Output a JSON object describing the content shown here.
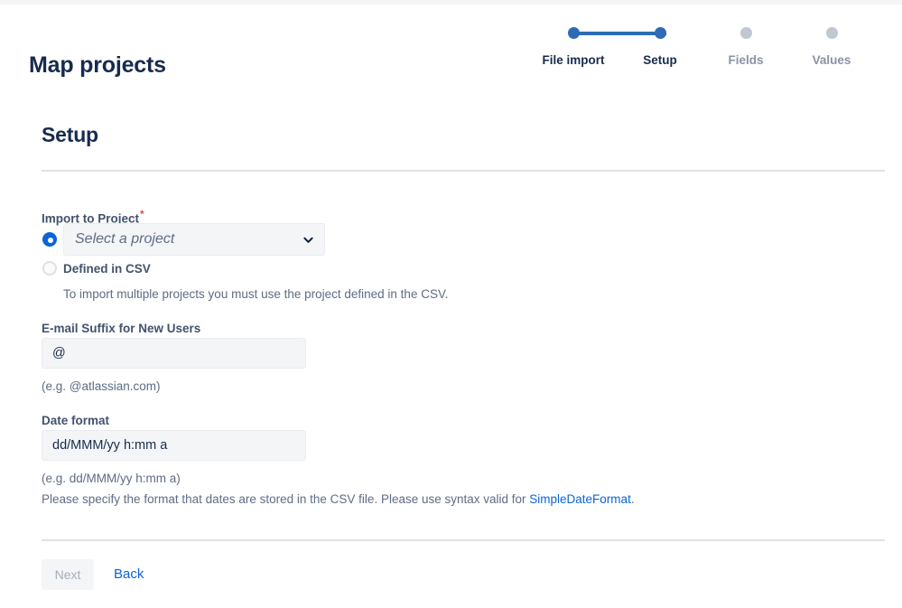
{
  "header": {
    "title": "Map projects"
  },
  "stepper": {
    "steps": [
      {
        "label": "File import",
        "state": "done"
      },
      {
        "label": "Setup",
        "state": "current"
      },
      {
        "label": "Fields",
        "state": "upcoming"
      },
      {
        "label": "Values",
        "state": "upcoming"
      }
    ],
    "active_color": "#2D6CB5",
    "inactive_color": "#C1C7D0"
  },
  "section": {
    "title": "Setup"
  },
  "form": {
    "import_to_project": {
      "label": "Import to Project",
      "required_marker": "*",
      "option_select": {
        "selected": true,
        "placeholder": "Select a project",
        "chevron": "chevron-down-icon"
      },
      "option_csv": {
        "selected": false,
        "label": "Defined in CSV",
        "helper": "To import multiple projects you must use the project defined in the CSV."
      }
    },
    "email_suffix": {
      "label": "E-mail Suffix for New Users",
      "value": "@",
      "helper": "(e.g. @atlassian.com)"
    },
    "date_format": {
      "label": "Date format",
      "value": "dd/MMM/yy h:mm a",
      "helper": "(e.g. dd/MMM/yy h:mm a)",
      "note_before": "Please specify the format that dates are stored in the CSV file. Please use syntax valid for ",
      "note_link": "SimpleDateFormat",
      "note_after": "."
    }
  },
  "actions": {
    "next_label": "Next",
    "back_label": "Back",
    "link_color": "#0B64DA"
  }
}
